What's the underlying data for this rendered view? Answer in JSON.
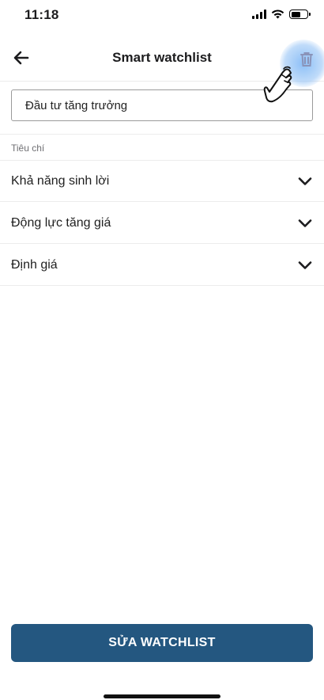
{
  "status_bar": {
    "time": "11:18",
    "battery_level": 0.65
  },
  "header": {
    "title": "Smart watchlist",
    "back_icon": "arrow-left-icon",
    "delete_icon": "trash-icon",
    "delete_color": "#8a93b8"
  },
  "name_field": {
    "value": "Đầu tư tăng trưởng"
  },
  "criteria": {
    "section_label": "Tiêu chí",
    "items": [
      {
        "label": "Khả năng sinh lời"
      },
      {
        "label": "Động lực tăng giá"
      },
      {
        "label": "Định giá"
      }
    ]
  },
  "footer": {
    "edit_button_label": "SỬA WATCHLIST",
    "accent_color": "#245780"
  }
}
